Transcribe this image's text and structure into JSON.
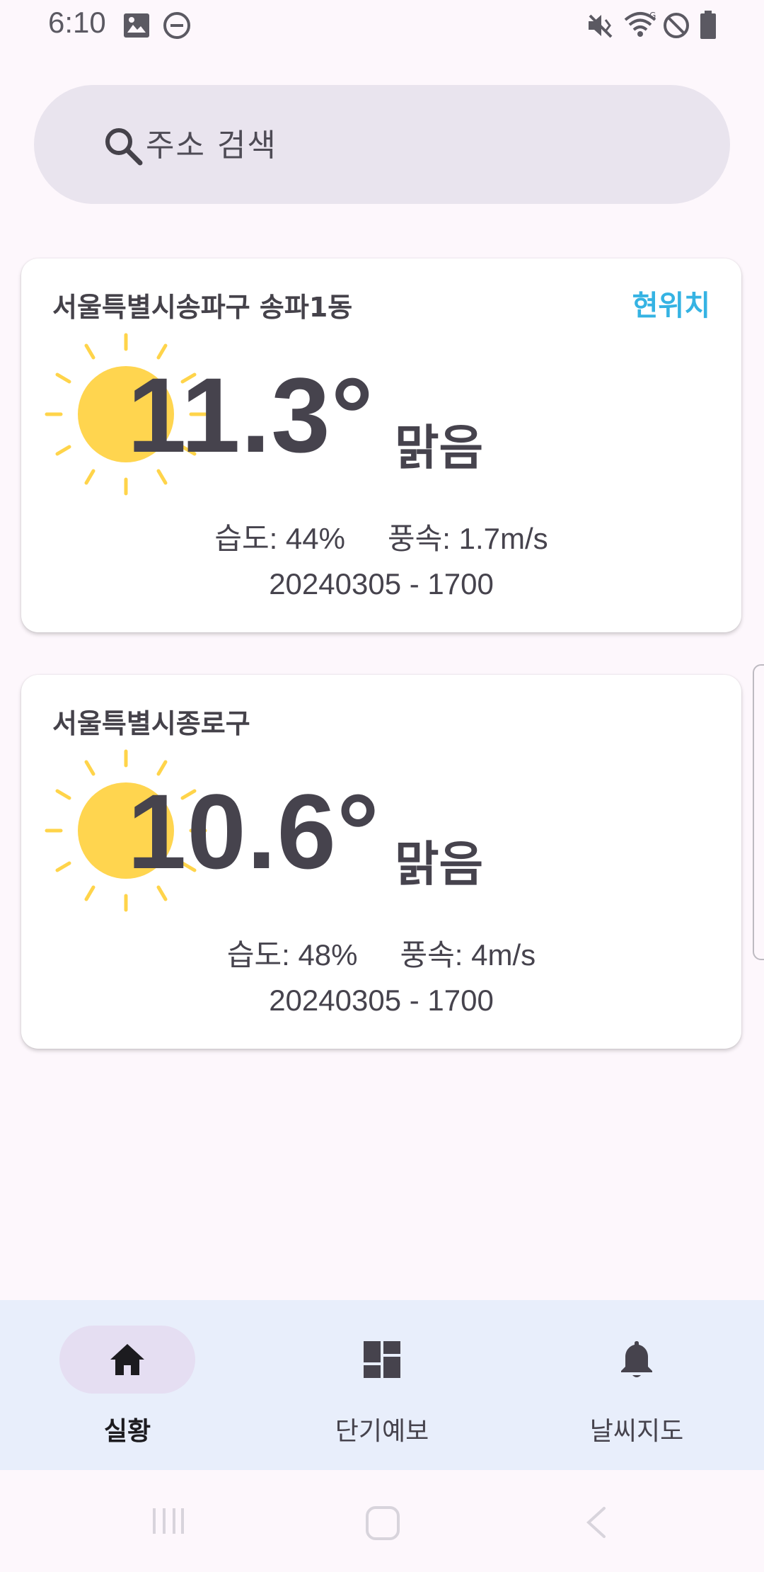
{
  "status_bar": {
    "time": "6:10",
    "icons": [
      "image-icon",
      "dnd-icon",
      "mute-vibrate-icon",
      "wifi-icon",
      "block-icon",
      "battery-icon"
    ]
  },
  "search": {
    "placeholder": "주소 검색",
    "value": ""
  },
  "cards": [
    {
      "location": "서울특별시송파구 송파1동",
      "badge": "현위치",
      "temperature": "11.3°",
      "condition": "맑음",
      "humidity": "습도: 44%",
      "wind": "풍속: 1.7m/s",
      "timestamp": "20240305 - 1700",
      "icon": "sun-icon"
    },
    {
      "location": "서울특별시종로구",
      "temperature": "10.6°",
      "condition": "맑음",
      "humidity": "습도: 48%",
      "wind": "풍속: 4m/s",
      "timestamp": "20240305 - 1700",
      "icon": "sun-icon"
    }
  ],
  "bottom_nav": {
    "items": [
      {
        "label": "실황",
        "icon": "home-icon",
        "active": true
      },
      {
        "label": "단기예보",
        "icon": "dashboard-icon",
        "active": false
      },
      {
        "label": "날씨지도",
        "icon": "bell-icon",
        "active": false
      }
    ]
  },
  "system_nav": [
    "recents-icon",
    "home-button-icon",
    "back-icon"
  ],
  "colors": {
    "background": "#FDF7FC",
    "accent_location": "#35B3E3",
    "sun": "#FFD54F",
    "sun_rays": "#FFD44A",
    "nav_background": "#E8EEFB",
    "nav_active_pill": "#E5DEF2",
    "text_dark": "#46434D"
  }
}
